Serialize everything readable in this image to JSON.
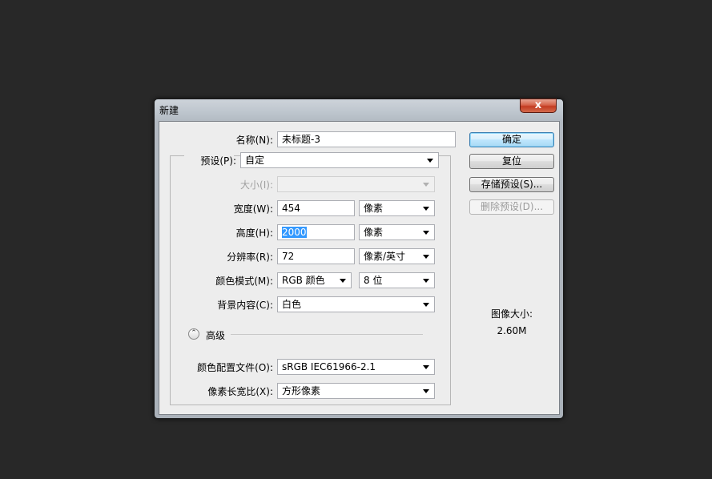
{
  "dialog": {
    "title": "新建",
    "close_label": "x"
  },
  "form": {
    "name": {
      "label": "名称(N):",
      "value": "未标题-3"
    },
    "preset": {
      "label": "预设(P):",
      "value": "自定"
    },
    "size": {
      "label": "大小(I):",
      "value": ""
    },
    "width": {
      "label": "宽度(W):",
      "value": "454",
      "unit": "像素"
    },
    "height": {
      "label": "高度(H):",
      "value": "2000",
      "unit": "像素"
    },
    "resolution": {
      "label": "分辨率(R):",
      "value": "72",
      "unit": "像素/英寸"
    },
    "color_mode": {
      "label": "颜色模式(M):",
      "value": "RGB 颜色",
      "depth": "8 位"
    },
    "background": {
      "label": "背景内容(C):",
      "value": "白色"
    },
    "advanced": {
      "label": "高级"
    },
    "color_profile": {
      "label": "颜色配置文件(O):",
      "value": "sRGB IEC61966-2.1"
    },
    "pixel_aspect": {
      "label": "像素长宽比(X):",
      "value": "方形像素"
    }
  },
  "buttons": {
    "ok": "确定",
    "reset": "复位",
    "save_preset": "存储预设(S)...",
    "delete_preset": "删除预设(D)..."
  },
  "image_size": {
    "label": "图像大小:",
    "value": "2.60M"
  },
  "icons": {
    "advanced_toggle": "chevron-up-double-icon",
    "dropdown": "triangle-down-icon"
  },
  "colors": {
    "background": "#282828",
    "client": "#ededed",
    "close_button": "#c33b21",
    "selection": "#3399ff"
  }
}
